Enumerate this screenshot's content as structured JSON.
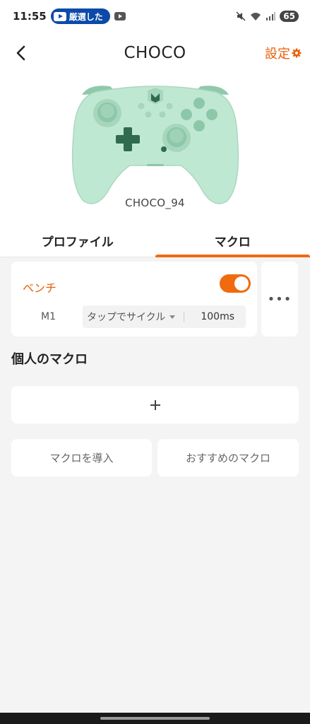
{
  "status_bar": {
    "time": "11:55",
    "notification_label": "厳選した",
    "battery": "65"
  },
  "header": {
    "title": "CHOCO",
    "settings_label": "設定"
  },
  "device": {
    "name": "CHOCO_94",
    "body_color": "#bfe8d2"
  },
  "tabs": [
    {
      "label": "プロファイル",
      "active": false
    },
    {
      "label": "マクロ",
      "active": true
    }
  ],
  "macro": {
    "name": "ベンチ",
    "enabled": true,
    "key": "M1",
    "mode": "タップでサイクル",
    "interval": "100ms"
  },
  "more_label": "•••",
  "section_title": "個人のマクロ",
  "add_label": "+",
  "buttons": {
    "import": "マクロを導入",
    "recommended": "おすすめのマクロ"
  },
  "colors": {
    "accent": "#f06a0f",
    "background": "#f4f4f4"
  }
}
